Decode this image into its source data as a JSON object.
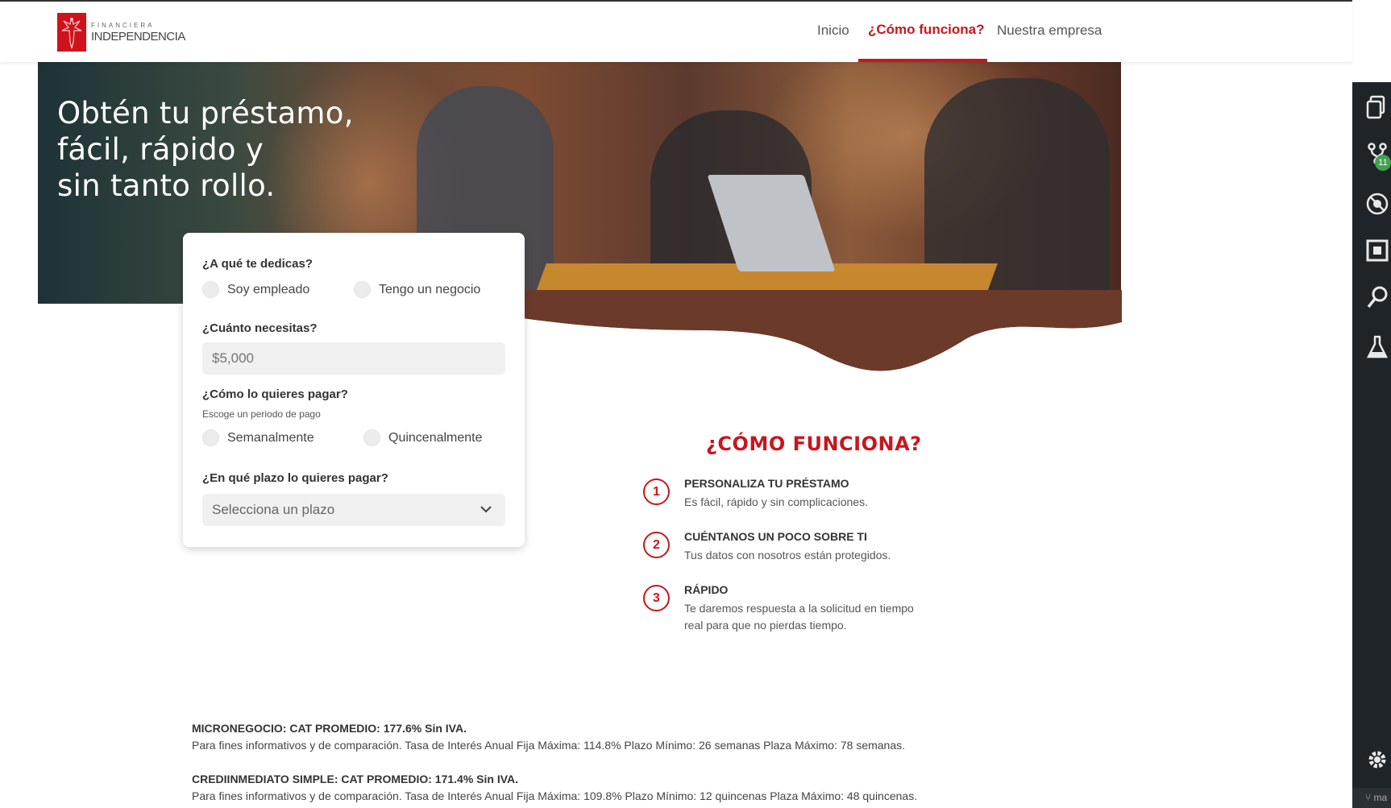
{
  "header": {
    "logo_small": "FINANCIERA",
    "logo_big": "INDEPENDENCIA",
    "nav": {
      "inicio": "Inicio",
      "como": "¿Cómo funciona?",
      "empresa": "Nuestra empresa"
    }
  },
  "hero": {
    "title_line1": "Obtén tu préstamo,",
    "title_line2": "fácil, rápido y",
    "title_line3": "sin tanto rollo."
  },
  "form": {
    "q1": "¿A qué te dedicas?",
    "q1_opt1": "Soy empleado",
    "q1_opt2": "Tengo un negocio",
    "q2": "¿Cuánto necesitas?",
    "q2_placeholder": "$5,000",
    "q3": "¿Cómo lo quieres pagar?",
    "q3_hint": "Escoge un periodo de pago",
    "q3_opt1": "Semanalmente",
    "q3_opt2": "Quincenalmente",
    "q4": "¿En qué plazo lo quieres pagar?",
    "q4_select": "Selecciona un plazo"
  },
  "how": {
    "title": "¿CÓMO FUNCIONA?",
    "steps": [
      {
        "num": "1",
        "title": "PERSONALIZA TU PRÉSTAMO",
        "desc": "Es fácil, rápido y sin complicaciones."
      },
      {
        "num": "2",
        "title": "CUÉNTANOS UN POCO SOBRE TI",
        "desc": "Tus datos con nosotros están protegidos."
      },
      {
        "num": "3",
        "title": "RÁPIDO",
        "desc": "Te daremos respuesta a la solicitud en tiempo real para que no pierdas tiempo."
      }
    ]
  },
  "legal": {
    "l1_title": "MICRONEGOCIO: CAT PROMEDIO: 177.6% Sin IVA.",
    "l1_text": "Para fines informativos y de comparación. Tasa de Interés Anual Fija Máxima: 114.8% Plazo Mínimo: 26 semanas Plaza Máximo: 78 semanas.",
    "l2_title": "CREDIINMEDIATO SIMPLE: CAT PROMEDIO: 171.4% Sin IVA.",
    "l2_text": "Para fines informativos y de comparación. Tasa de Interés Anual Fija Máxima: 109.8% Plazo Mínimo: 12 quincenas Plaza Máximo: 48 quincenas."
  },
  "ide": {
    "badge": "11",
    "bottom_text": "ma"
  },
  "colors": {
    "brand_red": "#c8161d",
    "ide_bg": "#1f2428",
    "badge_green": "#3fa34d"
  }
}
